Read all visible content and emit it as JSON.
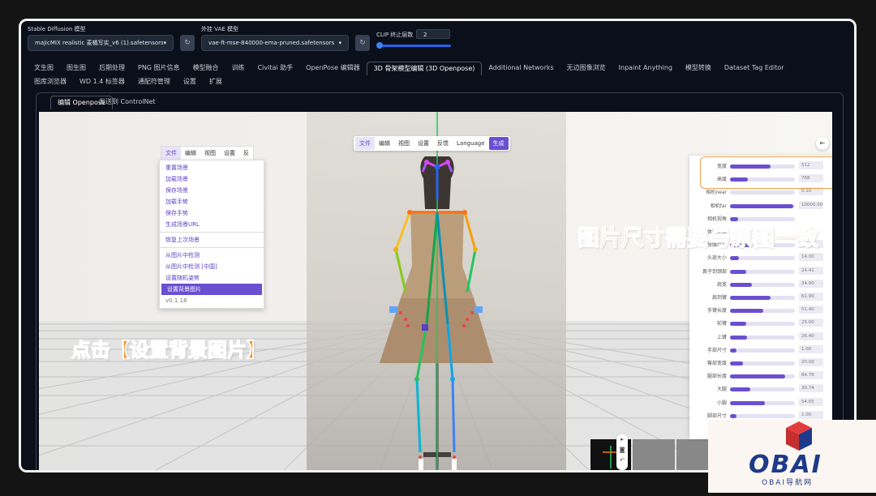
{
  "header": {
    "model_label": "Stable Diffusion 模型",
    "model_value": "majicMIX realistic 麦橘写实_v6 (1).safetensors [",
    "vae_label": "外挂 VAE 模型",
    "vae_value": "vae-ft-mse-840000-ema-pruned.safetensors",
    "clip_label": "CLIP 终止层数",
    "clip_value": "2"
  },
  "tabs_row1": [
    "文生图",
    "图生图",
    "后期处理",
    "PNG 图片信息",
    "模型融合",
    "训练",
    "Civitai 助手",
    "OpenPose 编辑器",
    "3D 骨架模型编辑 (3D Openpose)",
    "Additional Networks",
    "无边图像浏览",
    "Inpaint Anything",
    "模型转换",
    "Dataset Tag Editor"
  ],
  "tabs_row2": [
    "图库浏览器",
    "WD 1.4 标签器",
    "通配符管理",
    "设置",
    "扩展"
  ],
  "subtabs": [
    "编辑 Openpose",
    "发送到 ControlNet"
  ],
  "top_menu": [
    "文件",
    "编辑",
    "视图",
    "设置",
    "反馈",
    "Language",
    "生成"
  ],
  "left_menu": [
    "文件",
    "编辑",
    "视图",
    "设置",
    "反"
  ],
  "file_menu": {
    "group1": [
      "重置场景",
      "加载场景",
      "保存场景",
      "加载手势",
      "保存手势",
      "生成场景URL"
    ],
    "group2": [
      "恢复上次场景"
    ],
    "group3": [
      "从图片中检测",
      "从图片中检测 [中国]",
      "设置随机姿势",
      "设置背景图片"
    ],
    "version": "v0.1.18",
    "highlighted": "设置背景图片"
  },
  "params": [
    {
      "label": "宽度",
      "value": "512",
      "fill": 0.62
    },
    {
      "label": "高度",
      "value": "768",
      "fill": 0.28
    },
    {
      "label": "相机near",
      "value": "0.10",
      "fill": 0.0
    },
    {
      "label": "相机far",
      "value": "10000.00",
      "fill": 0.98
    },
    {
      "label": "相机视角",
      "value": "",
      "fill": 0.12
    },
    {
      "label": "体型参数",
      "value": "",
      "fill": 0.0
    },
    {
      "label": "骨骼厚度",
      "value": "1.00",
      "fill": 0.32
    },
    {
      "label": "头部大小",
      "value": "14.00",
      "fill": 0.14
    },
    {
      "label": "鼻子到颈部",
      "value": "24.41",
      "fill": 0.25
    },
    {
      "label": "肩宽",
      "value": "34.00",
      "fill": 0.34
    },
    {
      "label": "肩到臂",
      "value": "61.90",
      "fill": 0.62
    },
    {
      "label": "手臂长度",
      "value": "51.40",
      "fill": 0.51
    },
    {
      "label": "前臂",
      "value": "25.00",
      "fill": 0.25
    },
    {
      "label": "上臂",
      "value": "26.40",
      "fill": 0.26
    },
    {
      "label": "手部尺寸",
      "value": "1.00",
      "fill": 0.1
    },
    {
      "label": "臀部宽度",
      "value": "20.00",
      "fill": 0.2
    },
    {
      "label": "腿部长度",
      "value": "84.76",
      "fill": 0.85
    },
    {
      "label": "大腿",
      "value": "30.74",
      "fill": 0.31
    },
    {
      "label": "小腿",
      "value": "54.05",
      "fill": 0.54
    },
    {
      "label": "脚部尺寸",
      "value": "1.00",
      "fill": 0.1
    }
  ],
  "annotations": {
    "right": "图片尺寸需要与原图一致",
    "left": "点击【设置背景图片】"
  },
  "logo": {
    "name": "OBAI",
    "sub": "OBAI导航网"
  },
  "colors": {
    "accent": "#ff8c1a",
    "menu_purple": "#6a4fd1",
    "highlight_box": "#f0a050"
  }
}
